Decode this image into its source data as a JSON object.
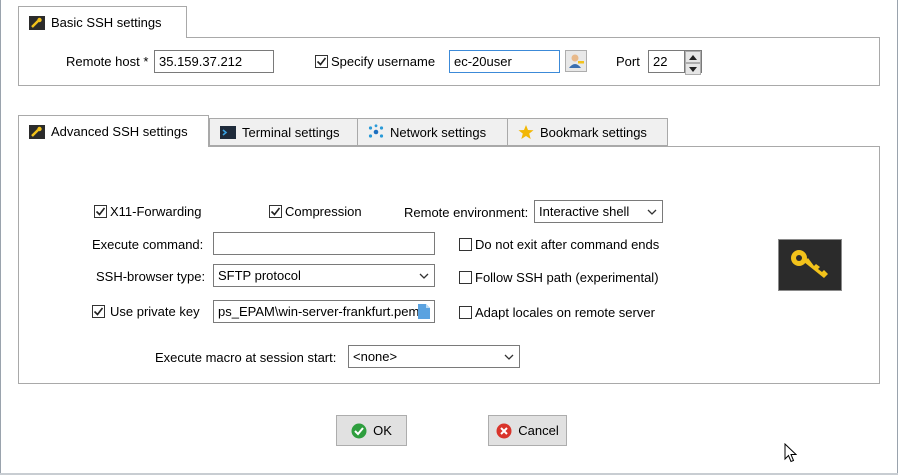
{
  "basic": {
    "tab_label": "Basic SSH settings",
    "remote_host_label": "Remote host *",
    "remote_host_value": "35.159.37.212",
    "specify_username_label": "Specify username",
    "specify_username_checked": true,
    "username_value": "ec-20user",
    "port_label": "Port",
    "port_value": "22"
  },
  "tabs": [
    {
      "label": "Advanced SSH settings",
      "icon": "wrench-icon",
      "active": true
    },
    {
      "label": "Terminal settings",
      "icon": "terminal-icon",
      "active": false
    },
    {
      "label": "Network settings",
      "icon": "network-icon",
      "active": false
    },
    {
      "label": "Bookmark settings",
      "icon": "star-icon",
      "active": false
    }
  ],
  "advanced": {
    "x11_label": "X11-Forwarding",
    "x11_checked": true,
    "compression_label": "Compression",
    "compression_checked": true,
    "remote_env_label": "Remote environment:",
    "remote_env_value": "Interactive shell",
    "exec_command_label": "Execute command:",
    "exec_command_value": "",
    "do_not_exit_label": "Do not exit after command ends",
    "do_not_exit_checked": false,
    "browser_type_label": "SSH-browser type:",
    "browser_type_value": "SFTP protocol",
    "follow_path_label": "Follow SSH path (experimental)",
    "follow_path_checked": false,
    "private_key_label": "Use private key",
    "private_key_checked": true,
    "private_key_value": "ps_EPAM\\win-server-frankfurt.pem",
    "adapt_locales_label": "Adapt locales on remote server",
    "adapt_locales_checked": false,
    "macro_label": "Execute macro at session start:",
    "macro_value": "<none>"
  },
  "buttons": {
    "ok_label": "OK",
    "cancel_label": "Cancel"
  },
  "colors": {
    "key_badge_bg": "#2b2b2b",
    "key_color": "#f2c21b",
    "ok_green": "#2e9e3e",
    "cancel_red": "#d9342b"
  }
}
